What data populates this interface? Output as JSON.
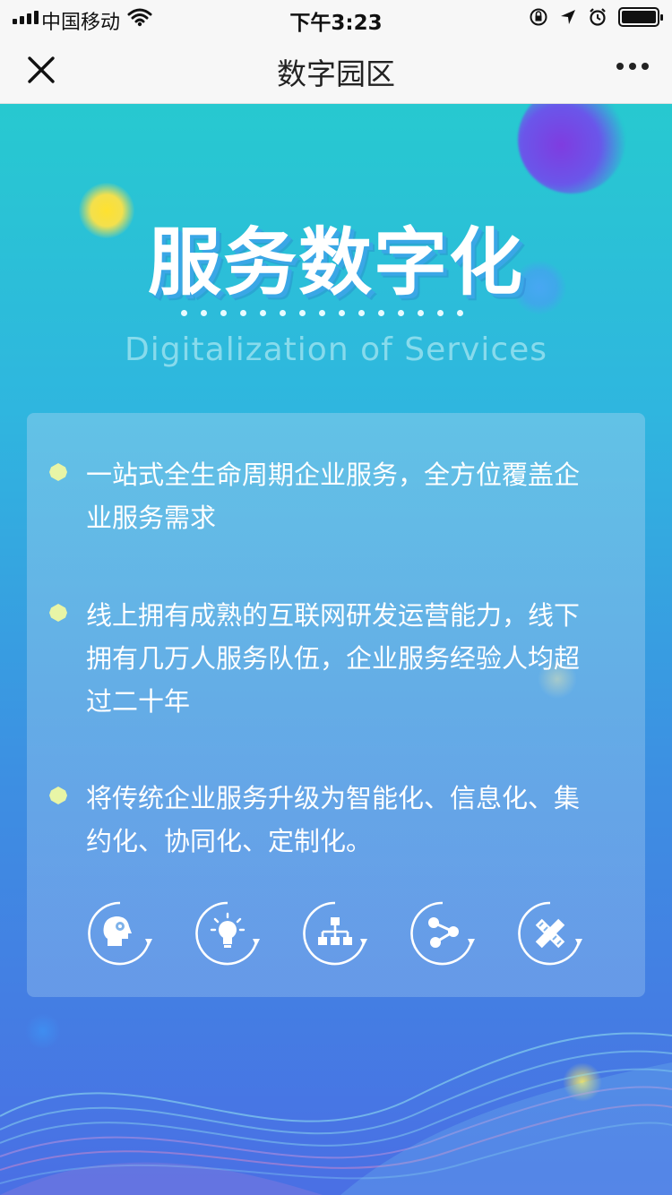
{
  "status_bar": {
    "carrier": "中国移动",
    "time": "下午3:23"
  },
  "nav": {
    "title": "数字园区"
  },
  "hero": {
    "title": "服务数字化",
    "subtitle": "Digitalization of Services"
  },
  "card": {
    "bullets": [
      {
        "text": "一站式全生命周期企业服务，全方位覆盖企业服务需求"
      },
      {
        "text": "线上拥有成熟的互联网研发运营能力，线下拥有几万人服务队伍，企业服务经验人均超过二十年"
      },
      {
        "text": "将传统企业服务升级为智能化、信息化、集约化、协同化、定制化。"
      }
    ],
    "icons": [
      {
        "name": "intelligence-head-icon"
      },
      {
        "name": "lightbulb-icon"
      },
      {
        "name": "org-chart-icon"
      },
      {
        "name": "share-nodes-icon"
      },
      {
        "name": "pencil-ruler-icon"
      }
    ]
  },
  "colors": {
    "bg_top": "#27c9d0",
    "bg_bottom": "#4a6fe4",
    "title_shadow": "#3aa7e6",
    "bullet_mark": "#e8f5a6"
  }
}
